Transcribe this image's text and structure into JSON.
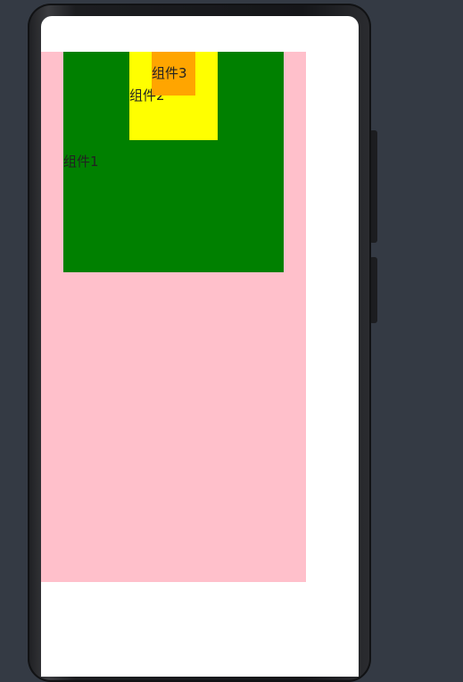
{
  "stack": {
    "components": [
      {
        "label": "组件1",
        "color": "#008000"
      },
      {
        "label": "组件2",
        "color": "#ffff00"
      },
      {
        "label": "组件3",
        "color": "#ffa500"
      }
    ],
    "background": "#ffc0cb"
  },
  "device": {
    "frame_color": "#1c1d20",
    "desktop_color": "#343a44",
    "screen_color": "#ffffff"
  }
}
